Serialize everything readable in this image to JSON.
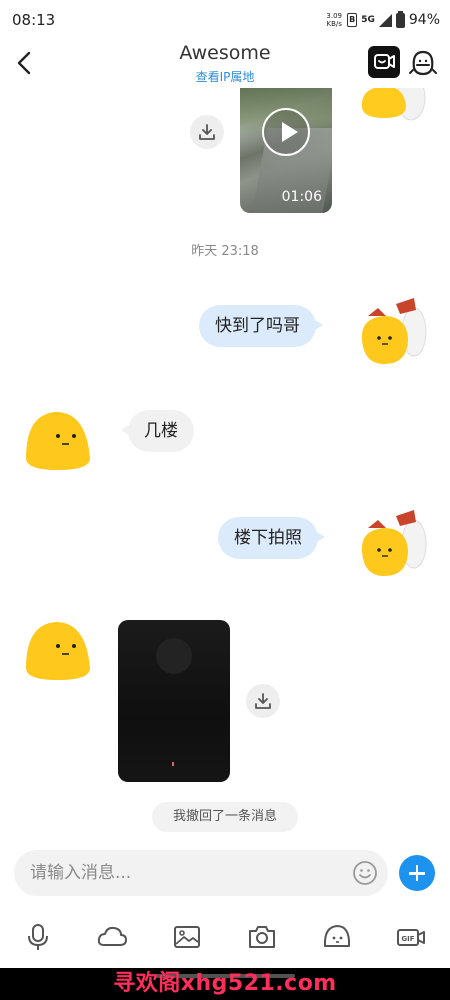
{
  "status_bar": {
    "time": "08:13",
    "net_speed_value": "3.09",
    "net_speed_unit": "KB/s",
    "sim": "B",
    "network": "5G",
    "battery": "94%"
  },
  "header": {
    "title": "Awesome",
    "subtitle": "查看IP属地"
  },
  "chat": {
    "video_1_duration": "01:06",
    "timestamp": "昨天 23:18",
    "messages": [
      {
        "from": "me",
        "text": "快到了吗哥"
      },
      {
        "from": "them",
        "text": "几楼"
      },
      {
        "from": "me",
        "text": "楼下拍照"
      }
    ],
    "recall_notice": "我撤回了一条消息"
  },
  "input": {
    "placeholder": "请输入消息..."
  },
  "toolbar": {
    "items": [
      "microphone-icon",
      "cloud-icon",
      "image-icon",
      "camera-icon",
      "emoji-icon",
      "gif-icon"
    ]
  },
  "watermark": "寻欢阁xhg521.com",
  "colors": {
    "accent": "#1d93ef",
    "bubble_me": "#dcebfb",
    "bubble_them": "#f1f1f1",
    "link": "#2f8cd8",
    "watermark": "#ff2e5a"
  }
}
